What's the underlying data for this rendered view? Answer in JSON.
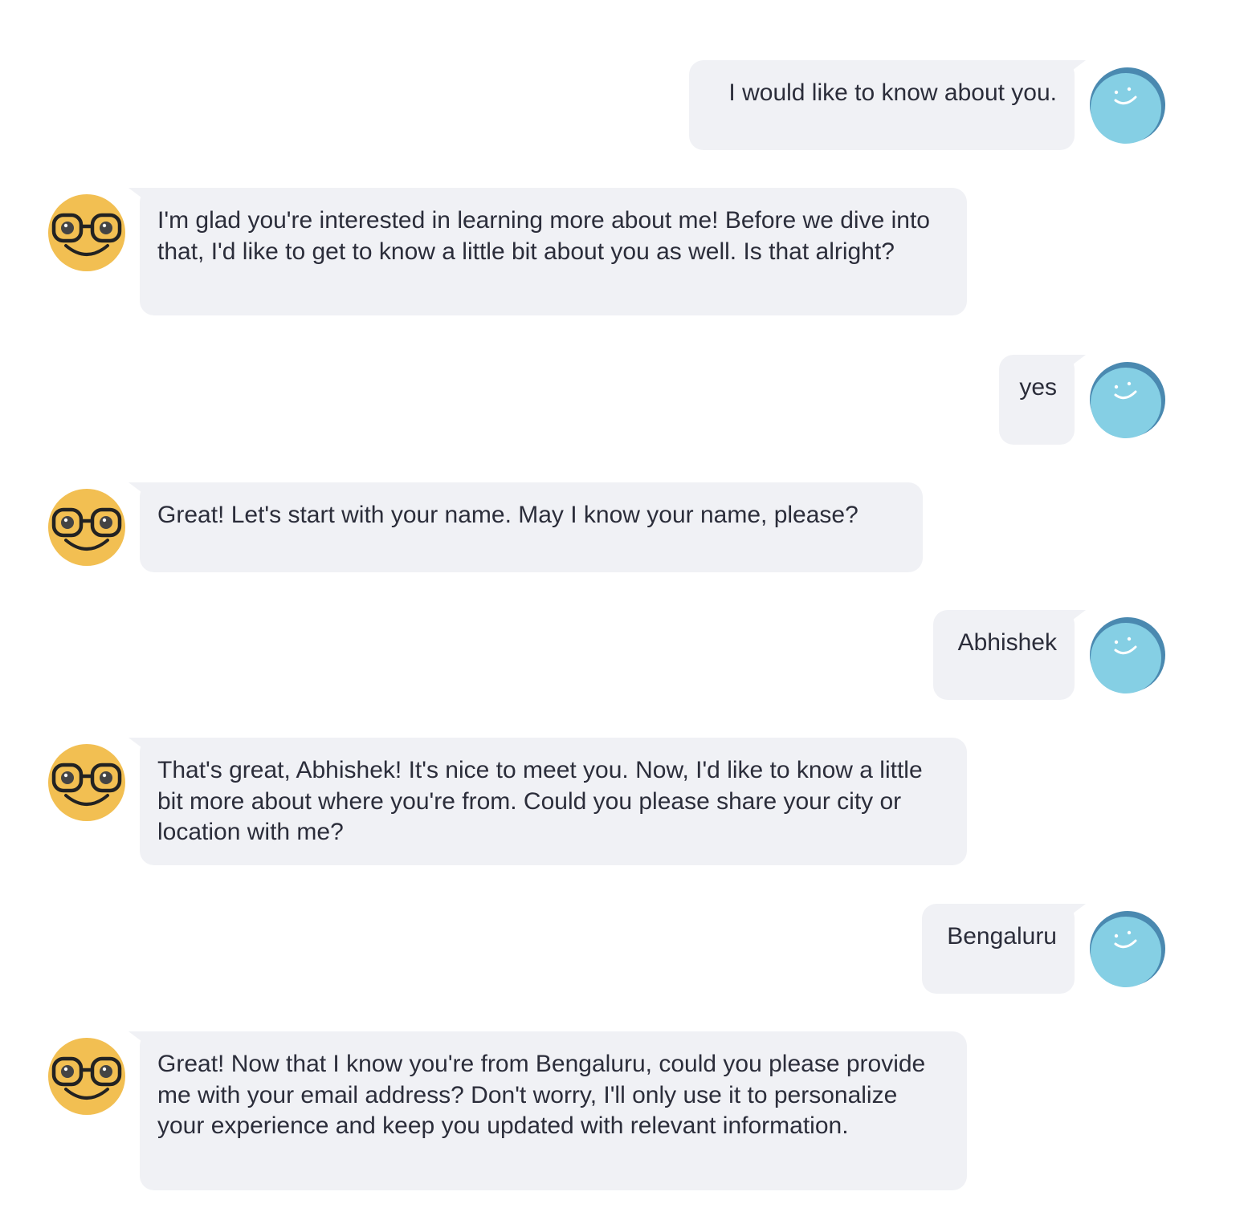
{
  "conversation": {
    "messages": [
      {
        "sender": "user",
        "text": "I would like to know about you.",
        "avatar_icon": "user-smiley-avatar-icon"
      },
      {
        "sender": "bot",
        "text": "I'm glad you're interested in learning more about me! Before we dive into that, I'd like to get to know a little bit about you as well. Is that alright?",
        "avatar_icon": "bot-nerd-glasses-avatar-icon"
      },
      {
        "sender": "user",
        "text": "yes",
        "avatar_icon": "user-smiley-avatar-icon"
      },
      {
        "sender": "bot",
        "text": "Great! Let's start with your name. May I know your name, please?",
        "avatar_icon": "bot-nerd-glasses-avatar-icon"
      },
      {
        "sender": "user",
        "text": "Abhishek",
        "avatar_icon": "user-smiley-avatar-icon"
      },
      {
        "sender": "bot",
        "text": "That's great, Abhishek! It's nice to meet you. Now, I'd like to know a little bit more about where you're from. Could you please share your city or location with me?",
        "avatar_icon": "bot-nerd-glasses-avatar-icon"
      },
      {
        "sender": "user",
        "text": "Bengaluru",
        "avatar_icon": "user-smiley-avatar-icon"
      },
      {
        "sender": "bot",
        "text": "Great! Now that I know you're from Bengaluru, could you please provide me with your email address? Don't worry, I'll only use it to personalize your experience and keep you updated with relevant information.",
        "avatar_icon": "bot-nerd-glasses-avatar-icon"
      }
    ]
  },
  "colors": {
    "bubble_background": "#f0f1f5",
    "text": "#2b2d3a",
    "user_avatar_fill": "#85cfe4",
    "user_avatar_rim": "#4a89b0",
    "bot_avatar_fill": "#f2bf52",
    "bot_glasses": "#222222"
  }
}
